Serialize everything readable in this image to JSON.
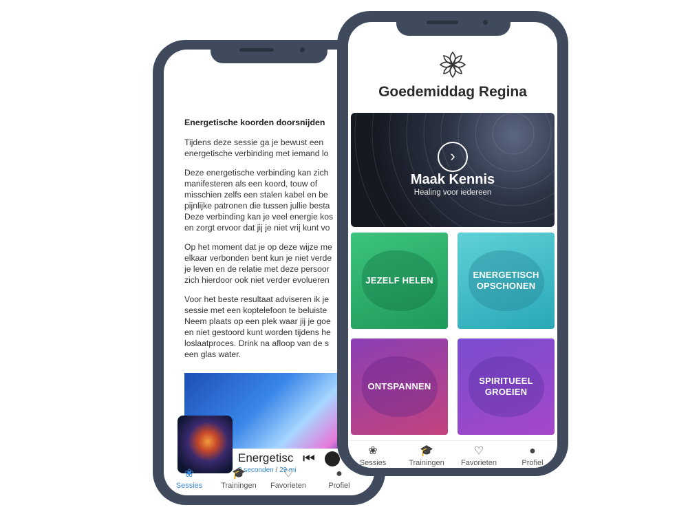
{
  "back_screen": {
    "article": {
      "title": "Energetische koorden doorsnijden",
      "paragraphs": [
        [
          "Tijdens deze sessie ga je bewust een",
          "energetische verbinding met iemand lo"
        ],
        [
          "Deze energetische verbinding kan zich",
          "manifesteren als een koord, touw of",
          "misschien zelfs een stalen kabel en be",
          "pijnlijke patronen die tussen jullie besta",
          "Deze verbinding kan je veel energie kos",
          "en zorgt ervoor dat jij je niet vrij kunt vo"
        ],
        [
          "Op het moment dat je op deze wijze me",
          "elkaar verbonden bent kun je niet verde",
          "je leven en de relatie met deze persoor",
          "zich hierdoor ook niet verder evolueren"
        ],
        [
          "Voor het beste resultaat adviseren ik je",
          "sessie met een koptelefoon te beluiste",
          "Neem plaats op een plek waar jij je goe",
          "en niet gestoord kunt worden tijdens he",
          "loslaatproces. Drink na afloop van de s",
          "een glas water."
        ]
      ]
    },
    "player": {
      "title": "Energetisc",
      "elapsed": "3 seconden",
      "separator": " / ",
      "total": "29 mi"
    },
    "nav": [
      {
        "label": "Sessies",
        "icon": "flower-icon",
        "active": true
      },
      {
        "label": "Trainingen",
        "icon": "graduation-cap-icon",
        "active": false
      },
      {
        "label": "Favorieten",
        "icon": "heart-icon",
        "active": false
      },
      {
        "label": "Profiel",
        "icon": "person-icon",
        "active": false
      }
    ]
  },
  "front_screen": {
    "greeting": "Goedemiddag Regina",
    "hero": {
      "title": "Maak Kennis",
      "subtitle": "Healing voor iedereen"
    },
    "tiles": [
      {
        "label_lines": [
          "JEZELF HELEN"
        ],
        "color": "#2fb26c"
      },
      {
        "label_lines": [
          "ENERGETISCH",
          "OPSCHONEN"
        ],
        "color": "#45bcc8"
      },
      {
        "label_lines": [
          "ONTSPANNEN"
        ],
        "color": "#a23f9d"
      },
      {
        "label_lines": [
          "SPIRITUEEL",
          "GROEIEN"
        ],
        "color": "#8c4acd"
      }
    ],
    "nav": [
      {
        "label": "Sessies",
        "icon": "flower-icon"
      },
      {
        "label": "Trainingen",
        "icon": "graduation-cap-icon"
      },
      {
        "label": "Favorieten",
        "icon": "heart-icon"
      },
      {
        "label": "Profiel",
        "icon": "person-icon"
      }
    ]
  },
  "colors": {
    "phone_frame": "#3f4a5c",
    "accent_blue": "#3a8bd8"
  }
}
